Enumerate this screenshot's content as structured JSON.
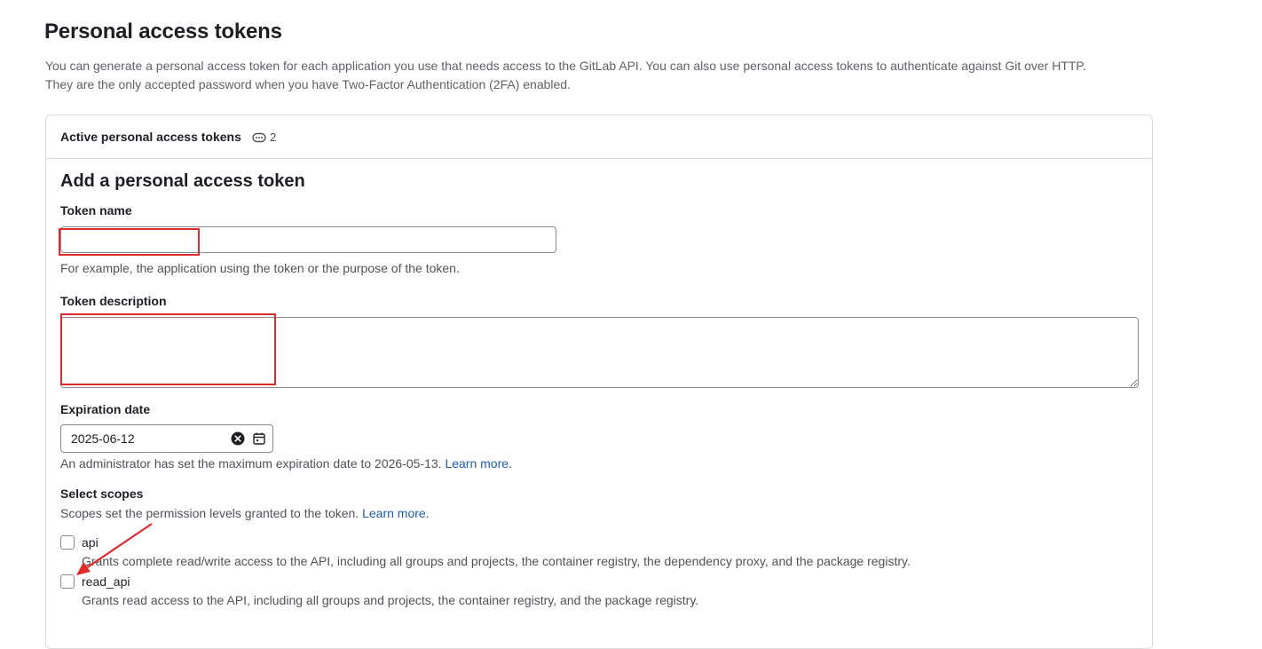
{
  "page": {
    "title": "Personal access tokens",
    "description_line1": "You can generate a personal access token for each application you use that needs access to the GitLab API. You can also use personal access tokens to authenticate against Git over HTTP.",
    "description_line2": "They are the only accepted password when you have Two-Factor Authentication (2FA) enabled."
  },
  "active_tokens": {
    "title": "Active personal access tokens",
    "count": "2",
    "count_icon": "token-icon"
  },
  "form": {
    "title": "Add a personal access token",
    "token_name": {
      "label": "Token name",
      "value": "",
      "help": "For example, the application using the token or the purpose of the token."
    },
    "token_description": {
      "label": "Token description",
      "value": ""
    },
    "expiration": {
      "label": "Expiration date",
      "value": "2025-06-12",
      "help_text": "An administrator has set the maximum expiration date to 2026-05-13.",
      "learn_more": "Learn more."
    },
    "scopes": {
      "label": "Select scopes",
      "help_text": "Scopes set the permission levels granted to the token.",
      "learn_more": "Learn more.",
      "items": [
        {
          "name": "api",
          "description": "Grants complete read/write access to the API, including all groups and projects, the container registry, the dependency proxy, and the package registry.",
          "checked": false
        },
        {
          "name": "read_api",
          "description": "Grants read access to the API, including all groups and projects, the container registry, and the package registry.",
          "checked": false
        }
      ]
    }
  },
  "colors": {
    "annotation": "#dd2b2b",
    "link": "#1f5fa8",
    "border": "#dcdcde"
  }
}
